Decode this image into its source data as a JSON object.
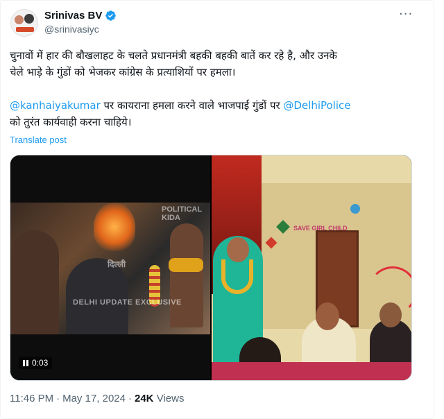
{
  "author": {
    "display_name": "Srinivas BV",
    "handle": "@srinivasiyc",
    "verified": true
  },
  "tweet": {
    "line1": "चुनावों में हार की बौखलाहट के चलते प्रधानमंत्री बहकी बहकी बातें कर रहे है, और उनके",
    "line2": "चेले भाड़े के गुंडों को भेजकर कांग्रेस के प्रत्याशियों पर हमला।",
    "mention1": "@kanhaiyakumar",
    "line3_mid": " पर कायराना हमला करने वाले भाजपाई गुंडों पर ",
    "mention2": "@DelhiPolice",
    "line4": "को तुरंत कार्यवाही करना चाहिये।"
  },
  "translate_label": "Translate post",
  "media": {
    "video_time": "0:03",
    "watermark_top": "POLITICAL KIDA",
    "watermark_bottom": "DELHI UPDATE EXCLUSIVE",
    "watermark_logo": "दिल्ली",
    "photo_board_text": "SAVE GIRL CHILD"
  },
  "meta": {
    "time": "11:46 PM",
    "date": "May 17, 2024",
    "views_count": "24K",
    "views_label": "Views"
  },
  "colors": {
    "link": "#1d9bf0",
    "verified": "#1d9bf0",
    "text": "#0f1419",
    "secondary": "#536471"
  },
  "icons": {
    "more": "more-icon",
    "verified": "verified-badge-icon",
    "pause": "pause-icon"
  }
}
